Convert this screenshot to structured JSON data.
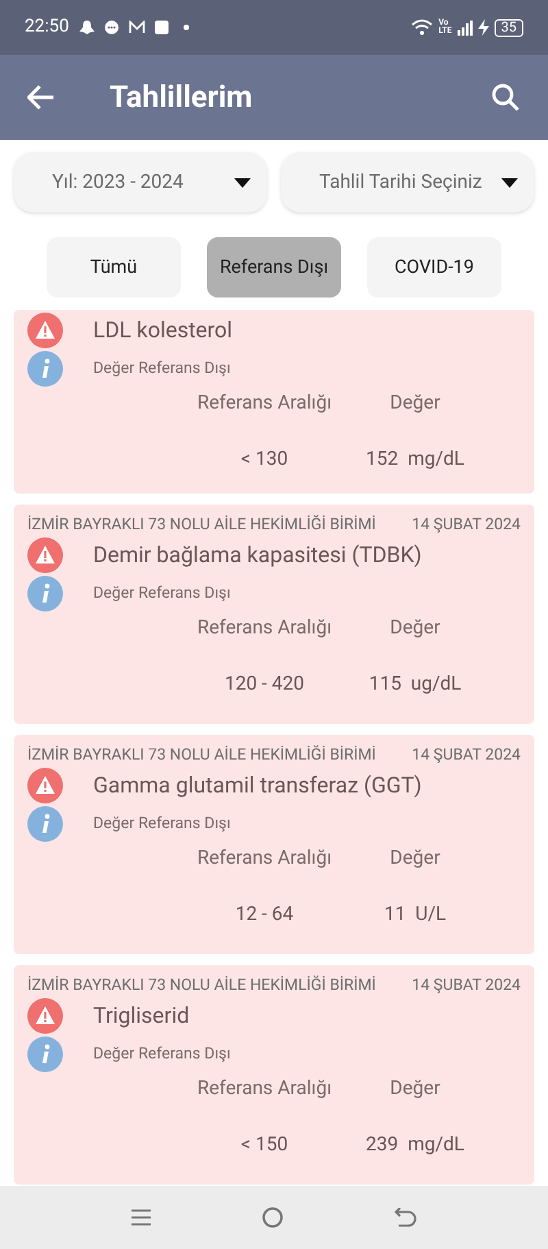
{
  "status_bar": {
    "time": "22:50",
    "network": [
      "Vo",
      "LTE"
    ],
    "battery": "35"
  },
  "app_bar": {
    "title": "Tahlillerim"
  },
  "filters": [
    {
      "value": "Yıl: 2023 - 2024"
    },
    {
      "value": "Tahlil Tarihi Seçiniz"
    }
  ],
  "tabs": [
    {
      "label": "Tümü",
      "selected": false
    },
    {
      "label": "Referans Dışı",
      "selected": true
    },
    {
      "label": "COVID-19",
      "selected": false
    }
  ],
  "results": [
    {
      "title": "LDL kolesterol",
      "status": "Değer Referans Dışı",
      "range_label": "Referans Aralığı",
      "value_label": "Değer",
      "range": "< 130",
      "value": "152  mg/dL"
    },
    {
      "facility": "İZMİR BAYRAKLI 73 NOLU AİLE HEKİMLİĞİ BİRİMİ",
      "date": "14 ŞUBAT 2024",
      "title": "Demir bağlama kapasitesi (TDBK)",
      "status": "Değer Referans Dışı",
      "range_label": "Referans Aralığı",
      "value_label": "Değer",
      "range": "120 - 420",
      "value": "115  ug/dL"
    },
    {
      "facility": "İZMİR BAYRAKLI 73 NOLU AİLE HEKİMLİĞİ BİRİMİ",
      "date": "14 ŞUBAT 2024",
      "title": "Gamma glutamil transferaz (GGT)",
      "status": "Değer Referans Dışı",
      "range_label": "Referans Aralığı",
      "value_label": "Değer",
      "range": "12 - 64",
      "value": "11  U/L"
    },
    {
      "facility": "İZMİR BAYRAKLI 73 NOLU AİLE HEKİMLİĞİ BİRİMİ",
      "date": "14 ŞUBAT 2024",
      "title": "Trigliserid",
      "status": "Değer Referans Dışı",
      "range_label": "Referans Aralığı",
      "value_label": "Değer",
      "range": "< 150",
      "value": "239  mg/dL"
    }
  ]
}
